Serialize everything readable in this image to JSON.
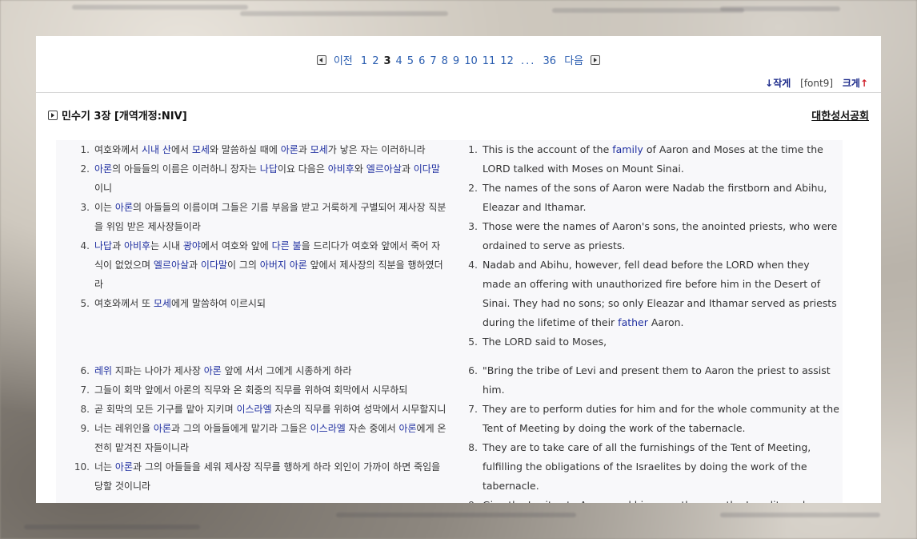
{
  "pagination": {
    "prev_label": "이전",
    "pages": [
      "1",
      "2",
      "3",
      "4",
      "5",
      "6",
      "7",
      "8",
      "9",
      "10",
      "11",
      "12"
    ],
    "current": "3",
    "ellipsis": "...",
    "last_page": "36",
    "next_label": "다음"
  },
  "font_controls": {
    "smaller_arrow": "↓",
    "smaller_label": "작게",
    "current_font": "[font9]",
    "larger_label": "크게",
    "larger_arrow": "↑"
  },
  "header": {
    "title": "민수기 3장 [개역개정:NIV]",
    "publisher": "대한성서공회"
  },
  "korean_verses": [
    {
      "num": "1.",
      "segments": [
        [
          "여호와께서 ",
          false
        ],
        [
          "시내 산",
          true
        ],
        [
          "에서 ",
          false
        ],
        [
          "모세",
          true
        ],
        [
          "와 말씀하실 때에 ",
          false
        ],
        [
          "아론",
          true
        ],
        [
          "과 ",
          false
        ],
        [
          "모세",
          true
        ],
        [
          "가 낳은 자는 이러하니라",
          false
        ]
      ]
    },
    {
      "num": "2.",
      "segments": [
        [
          "아론",
          true
        ],
        [
          "의 아들들의 이름은 이러하니 장자는 ",
          false
        ],
        [
          "나답",
          true
        ],
        [
          "이요 다음은 ",
          false
        ],
        [
          "아비후",
          true
        ],
        [
          "와 ",
          false
        ],
        [
          "엘르아살",
          true
        ],
        [
          "과 ",
          false
        ],
        [
          "이다말",
          true
        ],
        [
          "이니",
          false
        ]
      ]
    },
    {
      "num": "3.",
      "segments": [
        [
          "이는 ",
          false
        ],
        [
          "아론",
          true
        ],
        [
          "의 아들들의 이름이며 그들은 기름 부음을 받고 거룩하게 구별되어 제사장 직분을 위임 받은 제사장들이라",
          false
        ]
      ]
    },
    {
      "num": "4.",
      "segments": [
        [
          "나답",
          true
        ],
        [
          "과 ",
          false
        ],
        [
          "아비후",
          true
        ],
        [
          "는 시내 ",
          false
        ],
        [
          "광야",
          true
        ],
        [
          "에서 여호와 앞에 ",
          false
        ],
        [
          "다른 불",
          true
        ],
        [
          "을 드리다가 여호와 앞에서 죽어 자식이 없었으며 ",
          false
        ],
        [
          "엘르아살",
          true
        ],
        [
          "과 ",
          false
        ],
        [
          "이다말",
          true
        ],
        [
          "이 그의 ",
          false
        ],
        [
          "아버지 아론",
          true
        ],
        [
          " 앞에서 제사장의 직분을 행하였더라",
          false
        ]
      ]
    },
    {
      "num": "5.",
      "segments": [
        [
          "여호와께서 또 ",
          false
        ],
        [
          "모세",
          true
        ],
        [
          "에게 말씀하여 이르시되",
          false
        ]
      ]
    },
    {
      "num": "6.",
      "segments": [
        [
          "레위",
          true
        ],
        [
          " 지파는 나아가 제사장 ",
          false
        ],
        [
          "아론",
          true
        ],
        [
          " 앞에 서서 그에게 시종하게 하라",
          false
        ]
      ]
    },
    {
      "num": "7.",
      "segments": [
        [
          "그들이 회막 앞에서 아론의 직무와 온 회중의 직무를 위하여 회막에서 시무하되",
          false
        ]
      ]
    },
    {
      "num": "8.",
      "segments": [
        [
          "곧 회막의 모든 기구를 맡아 지키며 ",
          false
        ],
        [
          "이스라엘",
          true
        ],
        [
          " 자손의 직무를 위하여 성막에서 시무할지니",
          false
        ]
      ]
    },
    {
      "num": "9.",
      "segments": [
        [
          "너는 레위인을 ",
          false
        ],
        [
          "아론",
          true
        ],
        [
          "과 그의 아들들에게 맡기라 그들은 ",
          false
        ],
        [
          "이스라엘",
          true
        ],
        [
          " 자손 중에서 ",
          false
        ],
        [
          "아론",
          true
        ],
        [
          "에게 온전히 맡겨진 자들이니라",
          false
        ]
      ]
    },
    {
      "num": "10.",
      "segments": [
        [
          "너는 ",
          false
        ],
        [
          "아론",
          true
        ],
        [
          "과 그의 아들들을 세워 제사장 직무를 행하게 하라 외인이 가까이 하면 죽임을 당할 것이니라",
          false
        ]
      ]
    }
  ],
  "english_verses": [
    {
      "num": "1.",
      "segments": [
        [
          "This is the account of the ",
          false
        ],
        [
          "family",
          true
        ],
        [
          " of Aaron and Moses at the time the LORD talked with Moses on Mount Sinai.",
          false
        ]
      ]
    },
    {
      "num": "2.",
      "segments": [
        [
          "The names of the sons of Aaron were Nadab the firstborn and Abihu, Eleazar and Ithamar.",
          false
        ]
      ]
    },
    {
      "num": "3.",
      "segments": [
        [
          "Those were the names of Aaron's sons, the anointed priests, who were ordained to serve as priests.",
          false
        ]
      ]
    },
    {
      "num": "4.",
      "segments": [
        [
          "Nadab and Abihu, however, fell dead before the LORD when they made an offering with unauthorized fire before him in the Desert of Sinai. They had no sons; so only Eleazar and Ithamar served as priests during the lifetime of their ",
          false
        ],
        [
          "father",
          true
        ],
        [
          " Aaron.",
          false
        ]
      ]
    },
    {
      "num": "5.",
      "segments": [
        [
          "The LORD said to Moses,",
          false
        ]
      ]
    },
    {
      "num": "6.",
      "segments": [
        [
          "\"Bring the tribe of Levi and present them to Aaron the priest to assist him.",
          false
        ]
      ]
    },
    {
      "num": "7.",
      "segments": [
        [
          "They are to perform duties for him and for the whole community at the Tent of Meeting by doing the work of the tabernacle.",
          false
        ]
      ]
    },
    {
      "num": "8.",
      "segments": [
        [
          "They are to take care of all the furnishings of the Tent of Meeting, fulfilling the obligations of the Israelites by doing the work of the tabernacle.",
          false
        ]
      ]
    },
    {
      "num": "9.",
      "segments": [
        [
          "Give the Levites to Aaron and his sons; they are the Israelites who are to be given wholly to him.",
          false
        ]
      ]
    }
  ],
  "colors": {
    "link": "#2a5db0",
    "name_highlight": "#1f2fa0",
    "up_arrow": "#d0202a",
    "content_bg": "#f8f8fa"
  }
}
